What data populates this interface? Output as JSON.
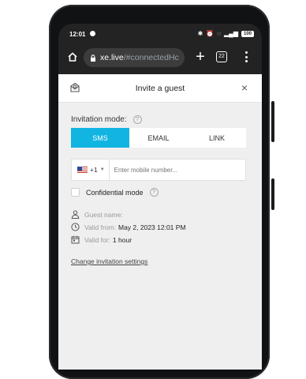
{
  "status_bar": {
    "time": "12:01",
    "right_icons": [
      "bluetooth-icon",
      "alarm-icon",
      "vibrate-icon",
      "signal-icon"
    ],
    "battery": "100"
  },
  "browser": {
    "url_host": "xe.live",
    "url_path": "/#connectedHc",
    "tab_count": "22"
  },
  "modal": {
    "title": "Invite a guest",
    "invitation_mode_label": "Invitation mode:",
    "modes": [
      {
        "label": "SMS",
        "active": true
      },
      {
        "label": "EMAIL",
        "active": false
      },
      {
        "label": "LINK",
        "active": false
      }
    ],
    "phone": {
      "country_code": "+1",
      "placeholder": "Enter mobile number..."
    },
    "confidential_label": "Confidential mode",
    "guest_name_label": "Guest name:",
    "valid_from_label": "Valid from:",
    "valid_from_value": "May 2, 2023 12:01 PM",
    "valid_for_label": "Valid for:",
    "valid_for_value": "1 hour",
    "change_link": "Change invitation settings"
  },
  "colors": {
    "accent": "#12b5e1",
    "page_bg": "#efefef",
    "browser_bg": "#232323"
  }
}
